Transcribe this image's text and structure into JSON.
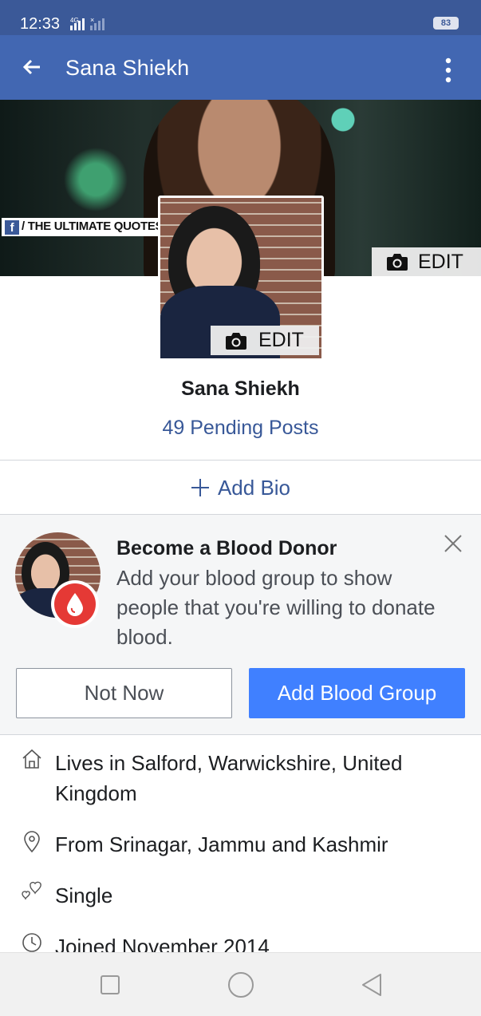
{
  "status_bar": {
    "time": "12:33",
    "network": "4G",
    "battery": "83"
  },
  "app_bar": {
    "title": "Sana Shiekh",
    "back_icon": "arrow-left-icon",
    "menu_icon": "more-vertical-icon"
  },
  "cover": {
    "watermark": "/ THE ULTIMATE QUOTES",
    "edit_label": "EDIT"
  },
  "profile": {
    "edit_label": "EDIT",
    "name": "Sana Shiekh",
    "pending_posts": "49 Pending Posts",
    "add_bio": "Add Bio"
  },
  "blood_donor": {
    "title": "Become a Blood Donor",
    "description": "Add your blood group to show people that you're willing to donate blood.",
    "not_now": "Not Now",
    "add_blood_group": "Add Blood Group"
  },
  "intro": [
    {
      "icon": "home-icon",
      "text": "Lives in Salford, Warwickshire, United Kingdom"
    },
    {
      "icon": "location-pin-icon",
      "text": "From Srinagar, Jammu and Kashmir"
    },
    {
      "icon": "hearts-icon",
      "text": "Single"
    },
    {
      "icon": "clock-icon",
      "text": "Joined November 2014"
    }
  ],
  "colors": {
    "brand": "#4267b2",
    "link": "#385898",
    "primary_button": "#4080ff"
  }
}
